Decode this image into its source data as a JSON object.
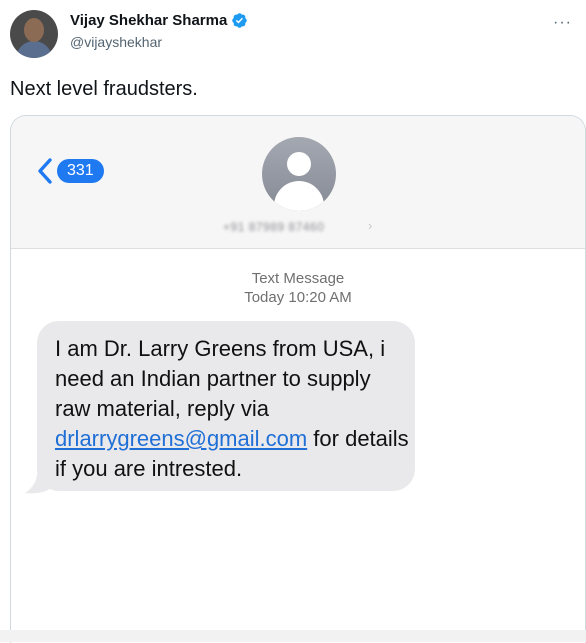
{
  "tweet": {
    "display_name": "Vijay Shekhar Sharma",
    "handle": "@vijayshekhar",
    "more_label": "···",
    "text": "Next level fraudsters."
  },
  "sms": {
    "back_count": "331",
    "contact_number": "+91 87989 87460",
    "contact_chevron": "›",
    "message_type": "Text Message",
    "timestamp": "Today 10:20 AM",
    "message_before_link": "I am Dr. Larry Greens from USA, i need an Indian partner to supply raw material, reply via ",
    "message_link": "drlarrygreens@gmail.com",
    "message_after_link": " for details if you are intrested."
  },
  "colors": {
    "verified": "#1d9bf0",
    "ios_blue": "#1f7af2",
    "bubble_gray": "#e9e9eb"
  },
  "icons": {
    "verified": "verified-badge-icon",
    "more": "more-options-icon",
    "back": "chevron-left-icon",
    "contact": "person-placeholder-icon"
  }
}
